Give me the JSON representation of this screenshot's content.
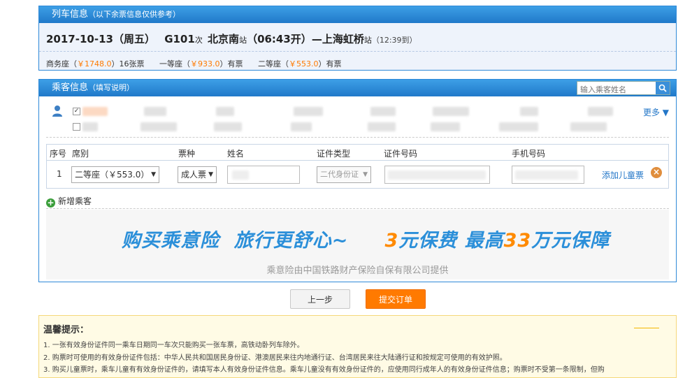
{
  "train_panel": {
    "title": "列车信息",
    "subtitle": "（以下余票信息仅供参考）",
    "date": "2017-10-13（周五）",
    "train_no": "G101",
    "train_no_suffix": "次",
    "from": "北京南",
    "from_suffix": "站",
    "depart": "（06:43开）",
    "dash": "—",
    "to": "上海虹桥",
    "to_suffix": "站",
    "arrive": "（12:39到）",
    "seats": [
      {
        "name": "商务座（",
        "price": "￥1748.0",
        "status": "）16张票"
      },
      {
        "name": "一等座（",
        "price": "￥933.0",
        "status": "）有票"
      },
      {
        "name": "二等座（",
        "price": "￥553.0",
        "status": "）有票"
      }
    ]
  },
  "passenger_panel": {
    "title": "乘客信息",
    "subtitle": "（填写说明）",
    "search_placeholder": "输入乘客姓名",
    "more_label": "更多 ▼",
    "table_headers": {
      "index": "序号",
      "seat": "席别",
      "ticket": "票种",
      "name": "姓名",
      "id_type": "证件类型",
      "id_no": "证件号码",
      "phone": "手机号码"
    },
    "row": {
      "index": "1",
      "seat": "二等座（￥553.0）",
      "ticket": "成人票",
      "id_type": "二代身份证",
      "add_child": "添加儿童票"
    },
    "add_passenger": "新增乘客",
    "banner": {
      "part1": "购买乘意险  旅行更舒心~     ",
      "num1": "3",
      "part2": "元保费  最高",
      "num2": "33",
      "part3": "万元保障",
      "provider": "乘意险由中国铁路财产保险自保有限公司提供"
    }
  },
  "buttons": {
    "prev": "上一步",
    "submit": "提交订单"
  },
  "tips": {
    "title": "温馨提示：",
    "items": [
      "1. 一张有效身份证件同一乘车日期同一车次只能购买一张车票，高铁动卧列车除外。",
      "2. 购票时可使用的有效身份证件包括：中华人民共和国居民身份证、港澳居民来往内地通行证、台湾居民来往大陆通行证和按规定可使用的有效护照。",
      "3. 购买儿童票时，乘车儿童有有效身份证件的，请填写本人有效身份证件信息。乘车儿童没有有效身份证件的，应使用同行成年人的有效身份证件信息；购票时不受第一条限制，但购"
    ]
  },
  "colors": {
    "header_blue": "#2079c9",
    "accent_orange": "#ff7a00",
    "link_blue": "#2477c8",
    "tips_bg": "#fffbe5"
  }
}
